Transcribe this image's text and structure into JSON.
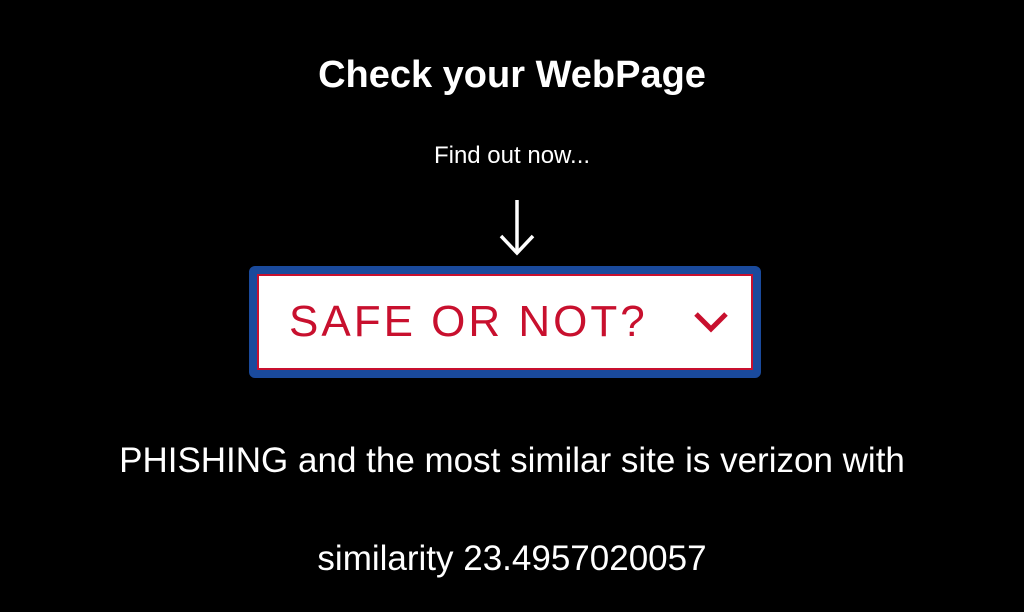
{
  "header": {
    "title": "Check your WebPage",
    "subtitle": "Find out now..."
  },
  "icons": {
    "arrow": "arrow-down-icon",
    "chevron": "chevron-down-icon"
  },
  "select": {
    "selected_label": "SAFE OR NOT?"
  },
  "result": {
    "line1": "PHISHING and the most similar site is verizon with",
    "line2": "similarity 23.4957020057"
  },
  "colors": {
    "background": "#000000",
    "text": "#ffffff",
    "select_text": "#c8102e",
    "select_border": "#c8102e",
    "focus_ring": "#1a4a9c"
  }
}
